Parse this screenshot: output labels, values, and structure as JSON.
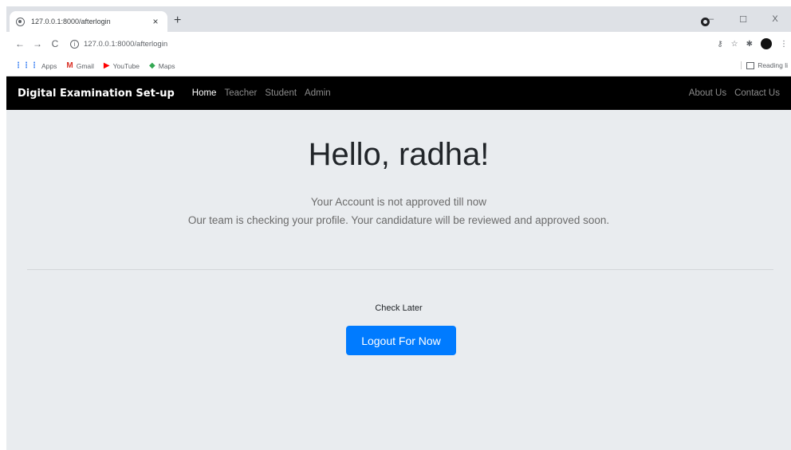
{
  "browser": {
    "tab_title": "127.0.0.1:8000/afterlogin",
    "tab_close": "×",
    "new_tab": "+",
    "url": "127.0.0.1:8000/afterlogin",
    "window_minimize": "–",
    "window_maximize": "☐",
    "window_close": "X",
    "bookmarks": [
      {
        "label": "Apps",
        "icon": "apps-grid-icon"
      },
      {
        "label": "Gmail",
        "icon": "gmail-icon"
      },
      {
        "label": "YouTube",
        "icon": "youtube-icon"
      },
      {
        "label": "Maps",
        "icon": "maps-icon"
      }
    ],
    "reading_list": "Reading li"
  },
  "navbar": {
    "brand": "Digital Examination Set-up",
    "links": [
      "Home",
      "Teacher",
      "Student",
      "Admin"
    ],
    "right_links": [
      "About Us",
      "Contact Us"
    ]
  },
  "main": {
    "greeting": "Hello, radha!",
    "line1": "Your Account is not approved till now",
    "line2": "Our team is checking your profile. Your candidature will be reviewed and approved soon.",
    "check_later": "Check Later",
    "logout_button": "Logout For Now"
  },
  "colors": {
    "navbar_bg": "#000000",
    "content_bg": "#e9ecef",
    "button_bg": "#007bff"
  }
}
